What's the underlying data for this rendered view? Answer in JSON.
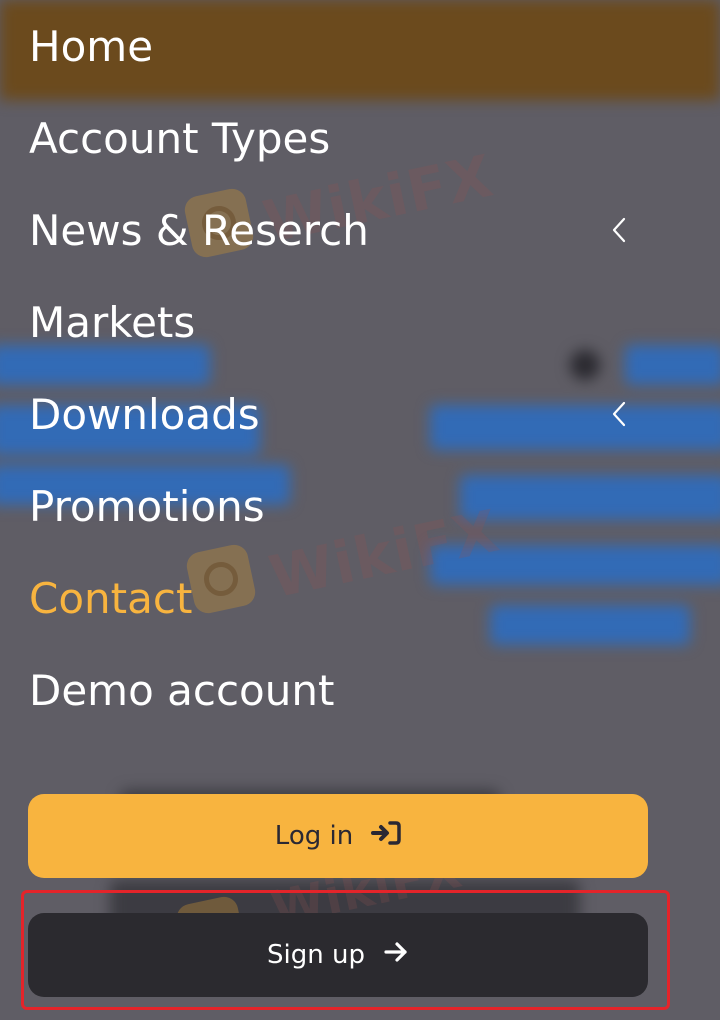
{
  "menu": {
    "items": [
      {
        "label": "Home",
        "has_chevron": false,
        "active": false
      },
      {
        "label": "Account Types",
        "has_chevron": false,
        "active": false
      },
      {
        "label": "News & Reserch",
        "has_chevron": true,
        "active": false
      },
      {
        "label": "Markets",
        "has_chevron": false,
        "active": false
      },
      {
        "label": "Downloads",
        "has_chevron": true,
        "active": false
      },
      {
        "label": "Promotions",
        "has_chevron": false,
        "active": false
      },
      {
        "label": "Contact",
        "has_chevron": false,
        "active": true
      },
      {
        "label": "Demo account",
        "has_chevron": false,
        "active": false
      }
    ],
    "chevron_icon": "chevron-left-icon"
  },
  "actions": {
    "login_label": "Log in",
    "login_icon": "sign-in-icon",
    "signup_label": "Sign up",
    "signup_icon": "arrow-right-icon"
  },
  "watermark": {
    "text": "WikiFX"
  },
  "colors": {
    "overlay": "#5f5d65",
    "accent": "#f8b43f",
    "active_text": "#f8b43f",
    "signup_bg": "#2b2a2f",
    "highlight": "#e4242a"
  }
}
